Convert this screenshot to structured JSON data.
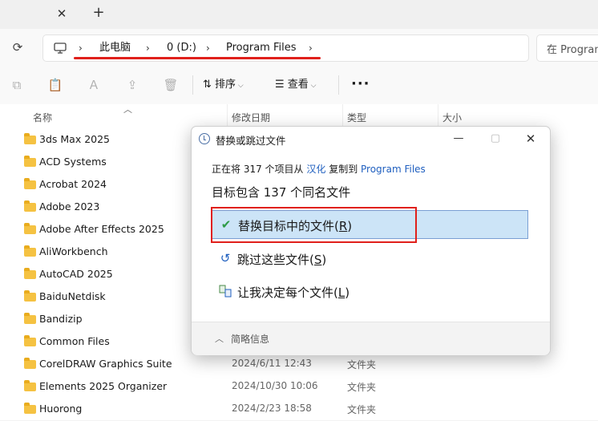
{
  "tabs": {
    "close_glyph": "✕",
    "new_glyph": "+"
  },
  "address": {
    "crumbs": [
      "此电脑",
      "0 (D:)",
      "Program Files"
    ],
    "separator": "›",
    "search_placeholder": "在 Program"
  },
  "toolbar": {
    "sort_label": "排序",
    "view_label": "查看",
    "more_label": "···"
  },
  "columns": {
    "name": "名称",
    "modified": "修改日期",
    "type": "类型",
    "size": "大小"
  },
  "files": [
    {
      "name": "3ds Max 2025",
      "date": "",
      "type": ""
    },
    {
      "name": "ACD Systems",
      "date": "",
      "type": ""
    },
    {
      "name": "Acrobat 2024",
      "date": "",
      "type": ""
    },
    {
      "name": "Adobe 2023",
      "date": "",
      "type": ""
    },
    {
      "name": "Adobe After Effects 2025",
      "date": "",
      "type": ""
    },
    {
      "name": "AliWorkbench",
      "date": "",
      "type": ""
    },
    {
      "name": "AutoCAD 2025",
      "date": "",
      "type": ""
    },
    {
      "name": "BaiduNetdisk",
      "date": "",
      "type": ""
    },
    {
      "name": "Bandizip",
      "date": "",
      "type": ""
    },
    {
      "name": "Common Files",
      "date": "",
      "type": ""
    },
    {
      "name": "CorelDRAW Graphics Suite",
      "date": "2024/6/11 12:43",
      "type": "文件夹"
    },
    {
      "name": "Elements 2025 Organizer",
      "date": "2024/10/30 10:06",
      "type": "文件夹"
    },
    {
      "name": "Huorong",
      "date": "2024/2/23 18:58",
      "type": "文件夹"
    }
  ],
  "dialog": {
    "title": "替换或跳过文件",
    "line1_prefix": "正在将 317 个项目从 ",
    "line1_source": "汉化",
    "line1_mid": " 复制到 ",
    "line1_dest": "Program Files",
    "line2": "目标包含 137 个同名文件",
    "options": [
      {
        "label": "替换目标中的文件(",
        "key": "R",
        "suffix": ")"
      },
      {
        "label": "跳过这些文件(",
        "key": "S",
        "suffix": ")"
      },
      {
        "label": "让我决定每个文件(",
        "key": "L",
        "suffix": ")"
      }
    ],
    "footer": "简略信息"
  },
  "colors": {
    "accent_link": "#1f5fbf",
    "selected_bg": "#cce4f7",
    "annotation_red": "#e0201b",
    "folder": "#f5c242"
  }
}
